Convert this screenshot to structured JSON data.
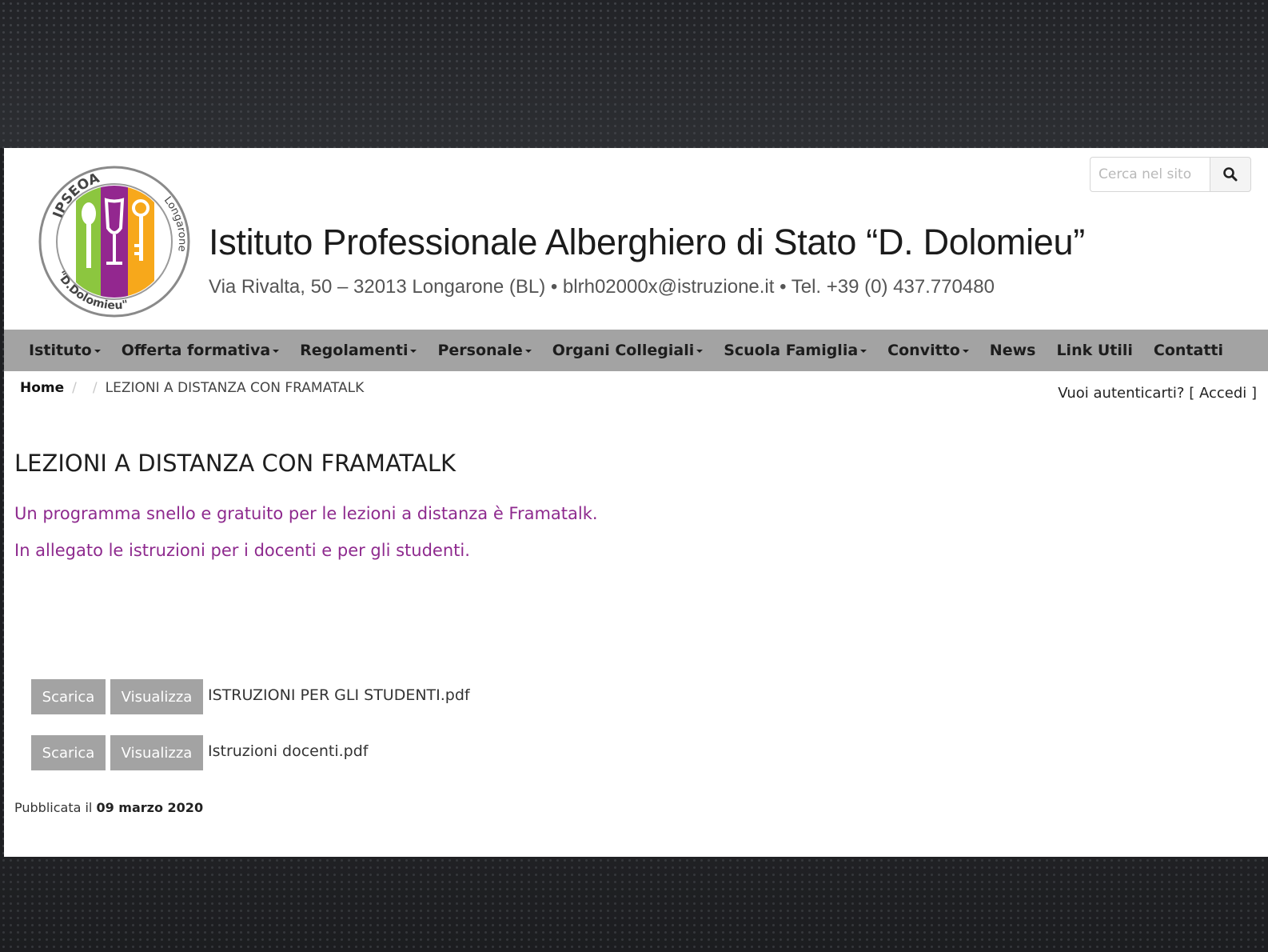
{
  "header": {
    "title": "Istituto Professionale Alberghiero di Stato “D. Dolomieu”",
    "address": "Via Rivalta, 50 – 32013 Longarone (BL) • blrh02000x@istruzione.it • Tel. +39 (0) 437.770480",
    "logo": {
      "text_top": "IPSEOA",
      "text_right": "Longarone",
      "text_bottom": "\"D.Dolomieu\"",
      "colors": [
        "#8cc63f",
        "#93278f",
        "#f7a81b"
      ]
    }
  },
  "search": {
    "placeholder": "Cerca nel sito",
    "icon": "search-icon"
  },
  "nav": {
    "items": [
      {
        "label": "Istituto",
        "dropdown": true
      },
      {
        "label": "Offerta formativa",
        "dropdown": true
      },
      {
        "label": "Regolamenti",
        "dropdown": true
      },
      {
        "label": "Personale",
        "dropdown": true
      },
      {
        "label": "Organi Collegiali",
        "dropdown": true
      },
      {
        "label": "Scuola Famiglia",
        "dropdown": true
      },
      {
        "label": "Convitto",
        "dropdown": true
      },
      {
        "label": "News",
        "dropdown": false
      },
      {
        "label": "Link Utili",
        "dropdown": false
      },
      {
        "label": "Contatti",
        "dropdown": false
      }
    ]
  },
  "breadcrumb": {
    "home": "Home",
    "separator": "/",
    "current": "LEZIONI A DISTANZA CON FRAMATALK"
  },
  "auth": {
    "prompt": "Vuoi autenticarti?",
    "link": "[ Accedi ]"
  },
  "article": {
    "title": "LEZIONI A DISTANZA CON FRAMATALK",
    "paragraphs": [
      "Un programma snello e gratuito per le lezioni a distanza è Framatalk.",
      "In allegato le istruzioni per i docenti e per gli studenti."
    ],
    "text_color": "#8e2a8e",
    "attachments": [
      {
        "download_label": "Scarica",
        "view_label": "Visualizza",
        "filename": "ISTRUZIONI PER GLI STUDENTI.pdf"
      },
      {
        "download_label": "Scarica",
        "view_label": "Visualizza",
        "filename": "Istruzioni docenti.pdf"
      }
    ],
    "published_prefix": "Pubblicata il",
    "published_date": "09 marzo 2020"
  },
  "colors": {
    "nav_bg": "#a3a3a3",
    "button_bg": "#a3a3a3"
  }
}
